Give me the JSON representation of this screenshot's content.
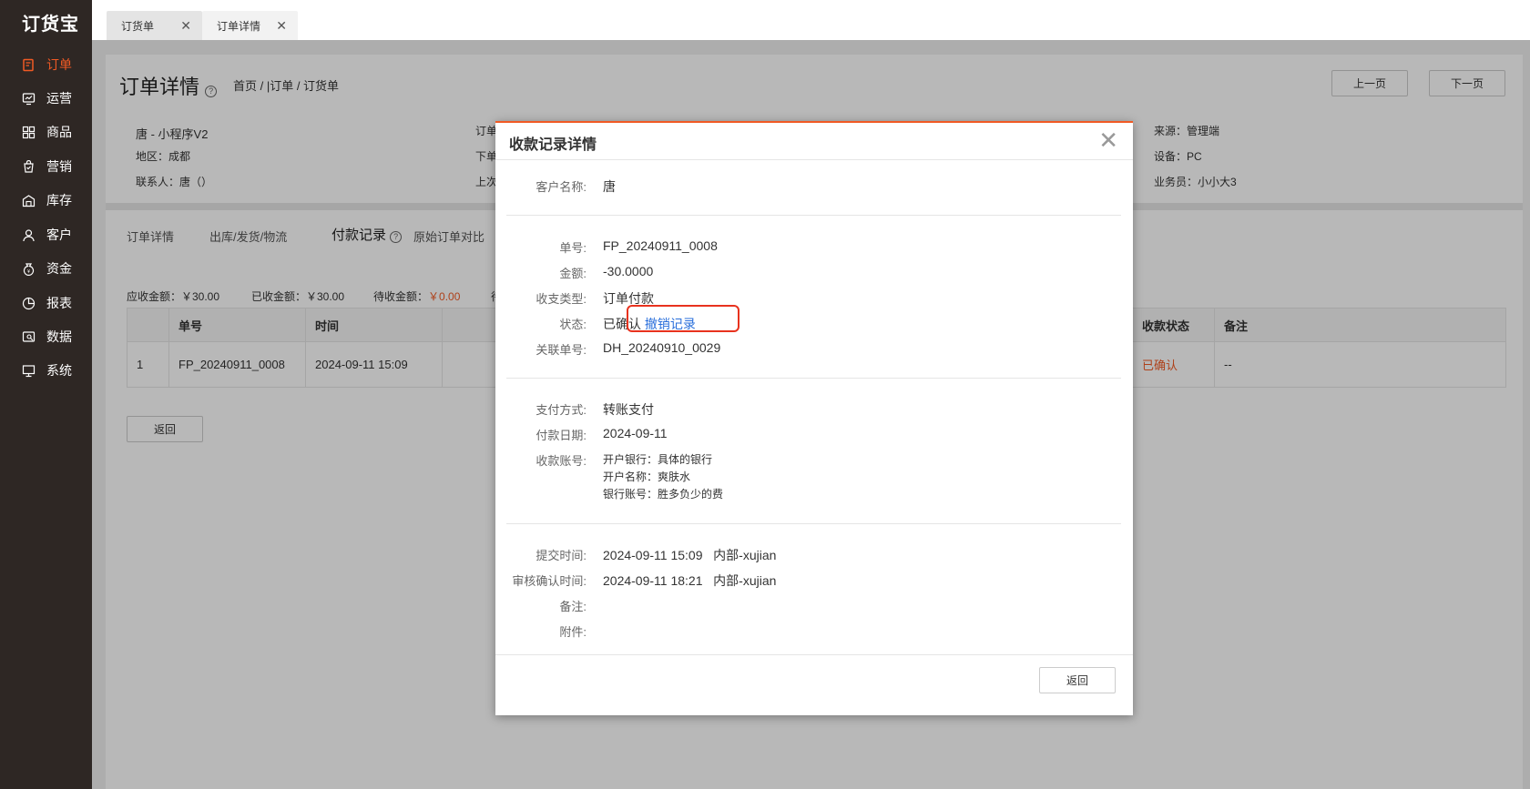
{
  "sidebar": {
    "logo": "订货宝",
    "items": [
      {
        "label": "订单",
        "icon": "order-icon"
      },
      {
        "label": "运营",
        "icon": "operations-icon"
      },
      {
        "label": "商品",
        "icon": "products-icon"
      },
      {
        "label": "营销",
        "icon": "marketing-icon"
      },
      {
        "label": "库存",
        "icon": "warehouse-icon"
      },
      {
        "label": "客户",
        "icon": "customer-icon"
      },
      {
        "label": "资金",
        "icon": "money-bag-icon"
      },
      {
        "label": "报表",
        "icon": "pie-chart-icon"
      },
      {
        "label": "数据",
        "icon": "data-icon"
      },
      {
        "label": "系统",
        "icon": "monitor-icon"
      }
    ],
    "active_color": "#f15a24"
  },
  "tabs": [
    {
      "label": "订货单"
    },
    {
      "label": "订单详情"
    }
  ],
  "page": {
    "title": "订单详情",
    "breadcrumb": "首页 / |订单 / 订货单",
    "prev_label": "上一页",
    "next_label": "下一页",
    "info": {
      "customer": "唐 - 小程序V2",
      "region": "地区：成都",
      "contact": "联系人：唐（）",
      "col2_a": "订单",
      "col2_b": "下单",
      "col2_c": "上次",
      "source": "来源：管理端",
      "device": "设备：PC",
      "salesman": "业务员：小小大3"
    },
    "subtabs": [
      "订单详情",
      "出库/发货/物流",
      "付款记录",
      "原始订单对比"
    ],
    "amounts": {
      "receivable": "应收金额：￥30.00",
      "received": "已收金额：￥30.00",
      "pending_label": "待收金额：",
      "pending_value": "￥0.00",
      "extra": "待"
    },
    "table": {
      "headers": [
        "",
        "单号",
        "时间",
        "收款状态",
        "备注"
      ],
      "rows": [
        {
          "idx": "1",
          "no": "FP_20240911_0008",
          "time": "2024-09-11 15:09",
          "status": "已确认",
          "note": "--"
        }
      ]
    },
    "back_label": "返回"
  },
  "modal": {
    "title": "收款记录详情",
    "customer_label": "客户名称:",
    "customer_value": "唐",
    "order_no_label": "单号:",
    "order_no_value": "FP_20240911_0008",
    "amount_label": "金额:",
    "amount_value": "-30.0000",
    "type_label": "收支类型:",
    "type_value": "订单付款",
    "status_label": "状态:",
    "status_value": "已确认",
    "revoke_link": "撤销记录",
    "related_label": "关联单号:",
    "related_value": "DH_20240910_0029",
    "pay_method_label": "支付方式:",
    "pay_method_value": "转账支付",
    "pay_date_label": "付款日期:",
    "pay_date_value": "2024-09-11",
    "account_label": "收款账号:",
    "account_bank": "开户银行：具体的银行",
    "account_name": "开户名称：爽肤水",
    "account_number": "银行账号：胜多负少的费",
    "submit_label": "提交时间:",
    "submit_value": "2024-09-11 15:09   内部-xujian",
    "confirm_label": "审核确认时间:",
    "confirm_value": "2024-09-11 18:21   内部-xujian",
    "remark_label": "备注:",
    "attachment_label": "附件:",
    "back_label": "返回",
    "highlight_color": "#e8321e",
    "link_color": "#2a6fdb"
  }
}
